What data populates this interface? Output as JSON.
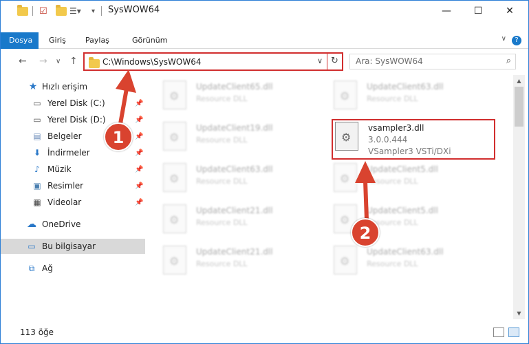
{
  "window": {
    "title": "SysWOW64",
    "minimize": "—",
    "maximize": "☐",
    "close": "✕"
  },
  "ribbon": {
    "tabs": [
      "Dosya",
      "Giriş",
      "Paylaş",
      "Görünüm"
    ],
    "help": "?"
  },
  "address": {
    "path": "C:\\Windows\\SysWOW64",
    "search_placeholder": "Ara: SysWOW64"
  },
  "sidebar": {
    "quick_access": "Hızlı erişim",
    "items": [
      {
        "label": "Yerel Disk (C:)",
        "icon": "drive-icon"
      },
      {
        "label": "Yerel Disk (D:)",
        "icon": "drive-icon"
      },
      {
        "label": "Belgeler",
        "icon": "documents-icon"
      },
      {
        "label": "İndirmeler",
        "icon": "downloads-icon"
      },
      {
        "label": "Müzik",
        "icon": "music-icon"
      },
      {
        "label": "Resimler",
        "icon": "pictures-icon"
      },
      {
        "label": "Videolar",
        "icon": "videos-icon"
      }
    ],
    "onedrive": "OneDrive",
    "this_pc": "Bu bilgisayar",
    "network": "Ağ"
  },
  "files": [
    {
      "name": "UpdateClient65.dll",
      "desc": "Resource DLL"
    },
    {
      "name": "UpdateClient63.dll",
      "desc": "Resource DLL"
    },
    {
      "name": "UpdateClient19.dll",
      "desc": "Resource DLL"
    },
    {
      "name": "UpdateClient63.dll",
      "desc": "Resource DLL"
    },
    {
      "name": "UpdateClient5.dll",
      "desc": "Resource DLL"
    },
    {
      "name": "UpdateClient21.dll",
      "desc": "Resource DLL"
    },
    {
      "name": "UpdateClient5.dll",
      "desc": "Resource DLL"
    },
    {
      "name": "UpdateClient21.dll",
      "desc": "Resource DLL"
    },
    {
      "name": "UpdateClient63.dll",
      "desc": "Resource DLL"
    }
  ],
  "highlighted_file": {
    "name": "vsampler3.dll",
    "version": "3.0.0.444",
    "desc": "VSampler3 VSTi/DXi"
  },
  "status": {
    "count": "113 öğe"
  },
  "annotations": {
    "step1": "1",
    "step2": "2",
    "color": "#d9432f"
  }
}
